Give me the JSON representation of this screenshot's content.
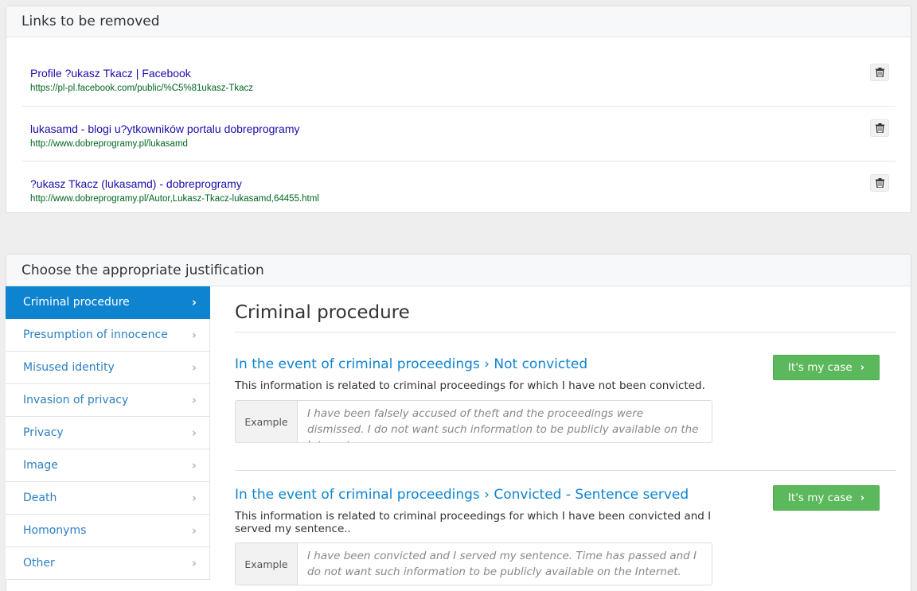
{
  "links_panel": {
    "title": "Links to be removed",
    "links": [
      {
        "title": "Profile ?ukasz Tkacz | Facebook",
        "url": "https://pl-pl.facebook.com/public/%C5%81ukasz-Tkacz"
      },
      {
        "title": "lukasamd - blogi u?ytkowników portalu dobreprogramy",
        "url": "http://www.dobreprogramy.pl/lukasamd"
      },
      {
        "title": "?ukasz Tkacz (lukasamd) - dobreprogramy",
        "url": "http://www.dobreprogramy.pl/Autor,Lukasz-Tkacz-lukasamd,64455.html"
      }
    ],
    "delete_icon": "trash-icon"
  },
  "justification_panel": {
    "title": "Choose the appropriate justification",
    "nav": [
      {
        "label": "Criminal procedure",
        "active": true
      },
      {
        "label": "Presumption of innocence"
      },
      {
        "label": "Misused identity"
      },
      {
        "label": "Invasion of privacy"
      },
      {
        "label": "Privacy"
      },
      {
        "label": "Image"
      },
      {
        "label": "Death"
      },
      {
        "label": "Homonyms"
      },
      {
        "label": "Other"
      }
    ],
    "nav_chevron": "›",
    "content_title": "Criminal procedure",
    "cases": [
      {
        "title": "In the event of criminal proceedings › Not convicted",
        "description": "This information is related to criminal proceedings for which I have not been convicted.",
        "example_label": "Example",
        "example_text": "I have been falsely accused of theft and the proceedings were dismissed. I do not want such information to be publicly available on the Internet.",
        "button_label": "It's my case"
      },
      {
        "title": "In the event of criminal proceedings › Convicted - Sentence served",
        "description": "This information is related to criminal proceedings for which I have been convicted and I served my sentence..",
        "example_label": "Example",
        "example_text": "I have been convicted and I served my sentence. Time has passed and I do not want such information to be publicly available on the Internet.",
        "button_label": "It's my case"
      }
    ]
  },
  "colors": {
    "accent": "#0e84d0",
    "button_green": "#5cb85c",
    "link_title": "#1a0dab",
    "link_url": "#006621"
  }
}
